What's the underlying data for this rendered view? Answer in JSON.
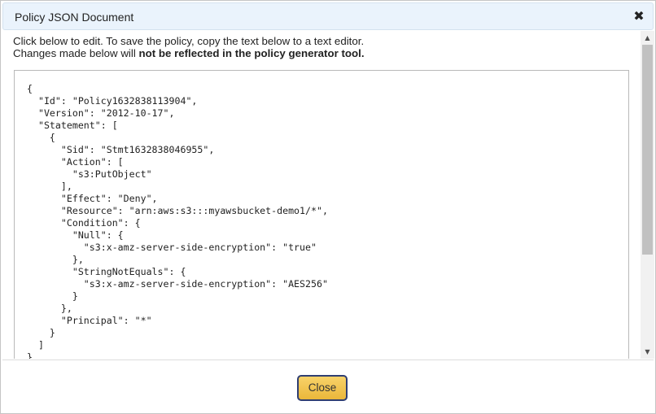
{
  "dialog": {
    "title": "Policy JSON Document",
    "close_icon": "close-icon"
  },
  "instructions": {
    "line1": "Click below to edit. To save the policy, copy the text below to a text editor.",
    "line2_prefix": "Changes made below will ",
    "line2_bold": "not be reflected in the policy generator tool."
  },
  "editor": {
    "policy_text": "{\n  \"Id\": \"Policy1632838113904\",\n  \"Version\": \"2012-10-17\",\n  \"Statement\": [\n    {\n      \"Sid\": \"Stmt1632838046955\",\n      \"Action\": [\n        \"s3:PutObject\"\n      ],\n      \"Effect\": \"Deny\",\n      \"Resource\": \"arn:aws:s3:::myawsbucket-demo1/*\",\n      \"Condition\": {\n        \"Null\": {\n          \"s3:x-amz-server-side-encryption\": \"true\"\n        },\n        \"StringNotEquals\": {\n          \"s3:x-amz-server-side-encryption\": \"AES256\"\n        }\n      },\n      \"Principal\": \"*\"\n    }\n  ]\n}"
  },
  "scrollbar": {
    "up_glyph": "▲",
    "down_glyph": "▼"
  },
  "footer": {
    "close_label": "Close"
  },
  "colors": {
    "titlebar_bg": "#eaf3fc",
    "button_bg": "#eab73a",
    "button_border": "#2f3e72"
  }
}
